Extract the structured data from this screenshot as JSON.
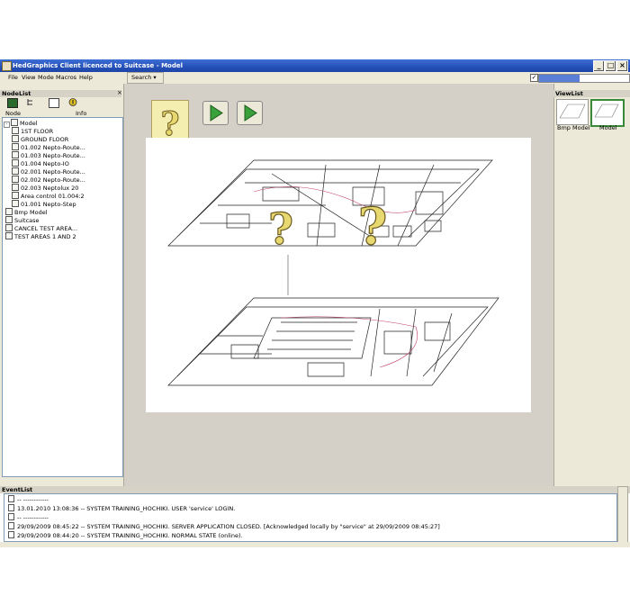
{
  "window": {
    "title": "HedGraphics Client licenced to Suitcase - Model"
  },
  "menu": {
    "items": [
      "File",
      "View",
      "Mode",
      "Macros",
      "Help"
    ],
    "search_label": "Search"
  },
  "nodelist": {
    "header": "NodeList",
    "columns": {
      "node": "Node",
      "info": "Info"
    },
    "items": [
      "Model",
      "1ST FLOOR",
      "GROUND FLOOR",
      "01.002 Nepto-Route...",
      "01.003 Nepto-Route...",
      "01.004 Nepto-IO",
      "02.001 Nepto-Route...",
      "02.002 Nepto-Route...",
      "02.003 Neptolux 20",
      "Area control 01.004:2",
      "01.001 Nepto-Step",
      "Bmp Model",
      "Suitcase",
      "CANCEL TEST AREA...",
      "TEST AREAS 1 AND 2"
    ]
  },
  "viewlist": {
    "header": "ViewList",
    "views": [
      "Bmp Model",
      "Model"
    ]
  },
  "eventlist": {
    "header": "EventList",
    "events": [
      "-- ------------",
      "13.01.2010 13:08:36 -- SYSTEM TRAINING_HOCHIKI. USER 'service' LOGIN.",
      "-- ------------",
      "29/09/2009 08:45:22 -- SYSTEM TRAINING_HOCHIKI. SERVER APPLICATION CLOSED. [Acknowledged locally by \"service\" at 29/09/2009 08:45:27]",
      "29/09/2009 08:44:20 -- SYSTEM TRAINING_HOCHIKI. NORMAL STATE (online)."
    ]
  },
  "status": {
    "progress_fraction": 0.45
  },
  "colors": {
    "titlebar": "#2450b8",
    "accent_yellow": "#e8d870",
    "play_green": "#3aa03a"
  }
}
